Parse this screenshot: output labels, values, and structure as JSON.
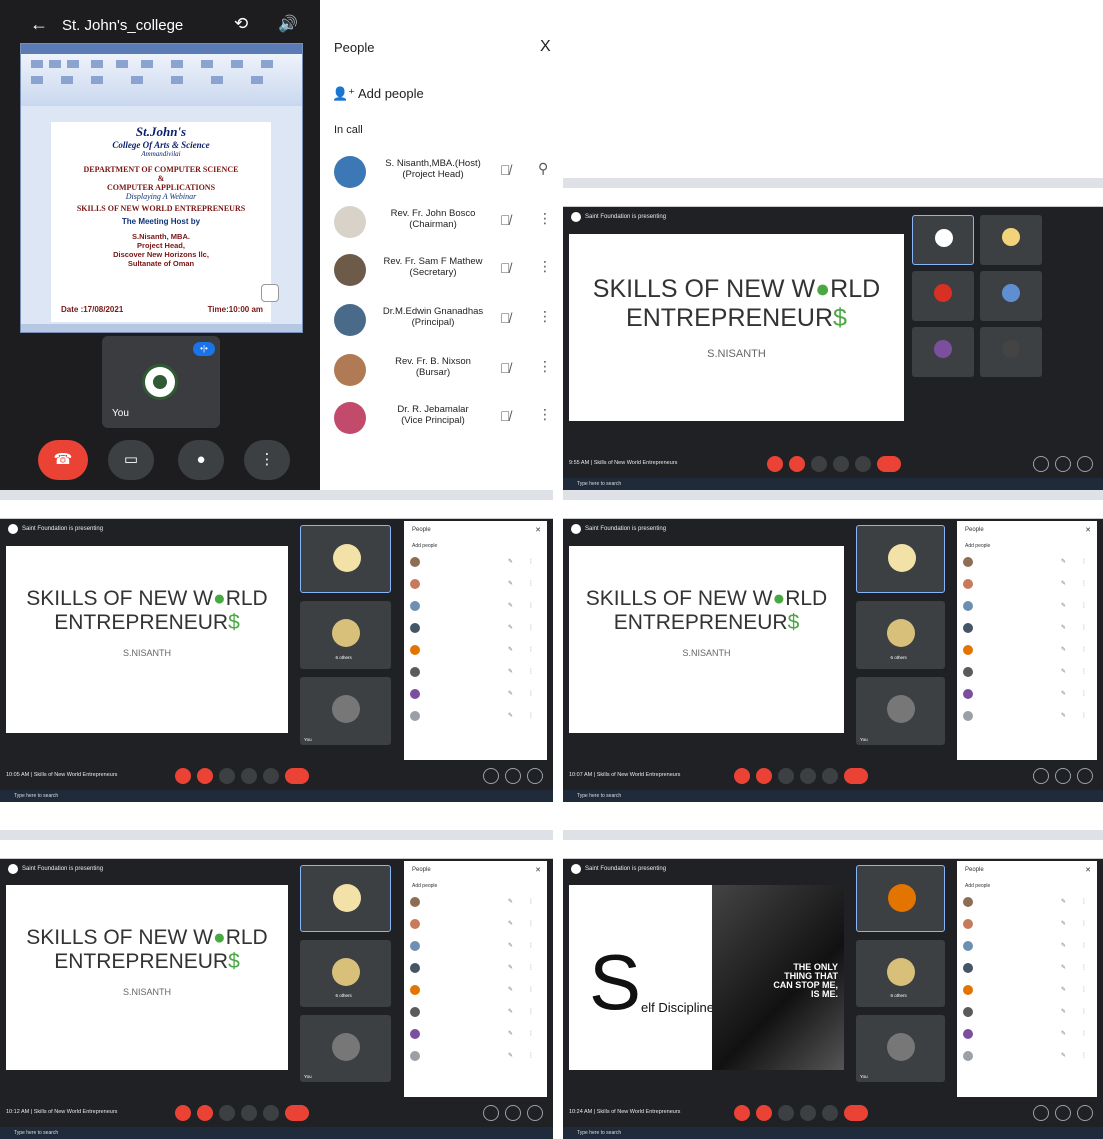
{
  "phone": {
    "back_icon": "←",
    "title": "St. John's_college",
    "icon_camera_switch": "⟲",
    "icon_speaker": "🔊",
    "word_title": "Skills Of New World Entrepreneurs",
    "page": {
      "college": "St.John's",
      "college_sub": "College Of Arts & Science",
      "place": "Ammandivilai",
      "dept1": "DEPARTMENT OF COMPUTER SCIENCE",
      "amp": "&",
      "dept2": "COMPUTER APPLICATIONS",
      "displaying": "Displaying A Webinar",
      "webinar": "SKILLS OF NEW WORLD ENTREPRENEURS",
      "host_line": "The Meeting Host by",
      "host_name": "S.Nisanth, MBA.",
      "host_role": "Project Head,",
      "host_org": "Discover New Horizons llc,",
      "host_country": "Sultanate of Oman",
      "date": "Date :17/08/2021",
      "time": "Time:10:00 am"
    },
    "you_label": "You"
  },
  "people_panel": {
    "title": "People",
    "close": "X",
    "add_people": "Add people",
    "in_call": "In call",
    "members": [
      {
        "name": "S. Nisanth,MBA.(Host)",
        "role": "(Project Head)",
        "avatar_color": "#3b78b5"
      },
      {
        "name": "Rev. Fr. John Bosco",
        "role": "(Chairman)",
        "avatar_color": "#d8d2c8"
      },
      {
        "name": "Rev. Fr. Sam F Mathew",
        "role": "(Secretary)",
        "avatar_color": "#6d5a48"
      },
      {
        "name": "Dr.M.Edwin Gnanadhas",
        "role": "(Principal)",
        "avatar_color": "#4a6a8a"
      },
      {
        "name": "Rev. Fr. B. Nixson",
        "role": "(Bursar)",
        "avatar_color": "#b07a55"
      },
      {
        "name": "Dr. R. Jebamalar",
        "role": "(Vice Principal)",
        "avatar_color": "#c24a6a"
      }
    ]
  },
  "slide": {
    "line1_a": "SKILLS OF NEW W",
    "line1_b": "RLD",
    "line2_a": "ENTREPRENEUR",
    "line2_b": "$",
    "sub": "S.NISANTH",
    "self_s": "S",
    "self_rest": "elf Discipline",
    "lion_quote": "THE ONLY THING THAT CAN STOP ME, IS ME."
  },
  "meet": {
    "banner": "Saint Foundation is presenting",
    "meeting_name": "Skills of New World Entrepreneurs",
    "times": [
      "9:55 AM",
      "10:05 AM",
      "10:07 AM",
      "10:12 AM",
      "10:24 AM"
    ],
    "you": "You",
    "others": "6 others",
    "taskbar_search": "Type here to search"
  },
  "colors": {
    "meet_bg": "#202124",
    "tile_bg": "#3c4043",
    "hangup": "#ea4335",
    "accent_blue": "#1a73e8",
    "globe_green": "#4aa843"
  }
}
